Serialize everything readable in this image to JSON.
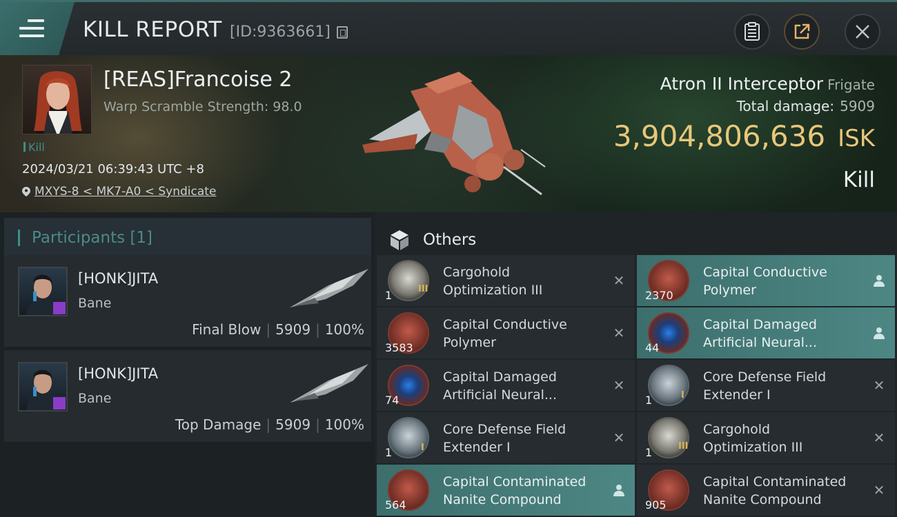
{
  "header": {
    "title": "KILL REPORT",
    "report_id": "[ID:9363661]",
    "icons": [
      "menu-icon",
      "copy-icon",
      "clipboard-icon",
      "share-icon",
      "close-icon"
    ]
  },
  "victim": {
    "name": "[REAS]Francoise 2",
    "warp_scramble": "Warp Scramble Strength: 98.0",
    "tag": "Kill",
    "timestamp": "2024/03/21 06:39:43 UTC +8",
    "location": "MXYS-8 < MK7-A0 < Syndicate",
    "ship": "Atron II Interceptor",
    "ship_class": "Frigate",
    "total_damage_label": "Total damage:",
    "total_damage": "5909",
    "isk_value": "3,904,806,636",
    "currency": "ISK",
    "result": "Kill"
  },
  "participants": {
    "title": "Participants [1]",
    "rows": [
      {
        "name": "[HONK]JITA",
        "ship": "Bane",
        "role": "Final Blow",
        "damage": "5909",
        "percent": "100%"
      },
      {
        "name": "[HONK]JITA",
        "ship": "Bane",
        "role": "Top Damage",
        "damage": "5909",
        "percent": "100%"
      }
    ]
  },
  "others": {
    "title": "Others",
    "items": [
      {
        "qty": "1",
        "name": "Cargohold Optimization III",
        "icon": "cargohold-icon",
        "action": "destroyed"
      },
      {
        "qty": "2370",
        "name": "Capital Conductive Polymer",
        "icon": "polymer-icon",
        "action": "dropped"
      },
      {
        "qty": "3583",
        "name": "Capital Conductive Polymer",
        "icon": "polymer-icon",
        "action": "destroyed"
      },
      {
        "qty": "44",
        "name": "Capital Damaged Artificial Neural...",
        "icon": "neural-icon",
        "action": "dropped"
      },
      {
        "qty": "74",
        "name": "Capital Damaged Artificial Neural...",
        "icon": "neural-icon",
        "action": "destroyed"
      },
      {
        "qty": "1",
        "name": "Core Defense Field Extender I",
        "icon": "shield-icon",
        "action": "destroyed"
      },
      {
        "qty": "1",
        "name": "Core Defense Field Extender I",
        "icon": "shield-icon",
        "action": "destroyed"
      },
      {
        "qty": "1",
        "name": "Cargohold Optimization III",
        "icon": "cargohold-icon",
        "action": "destroyed"
      },
      {
        "qty": "564",
        "name": "Capital Contaminated Nanite Compound",
        "icon": "nanite-icon",
        "action": "dropped"
      },
      {
        "qty": "905",
        "name": "Capital Contaminated Nanite Compound",
        "icon": "nanite-icon",
        "action": "destroyed"
      }
    ]
  },
  "colors": {
    "accent_teal": "#3e8e88",
    "isk_gold": "#e8c77a",
    "highlight_row": "#4d8784"
  }
}
